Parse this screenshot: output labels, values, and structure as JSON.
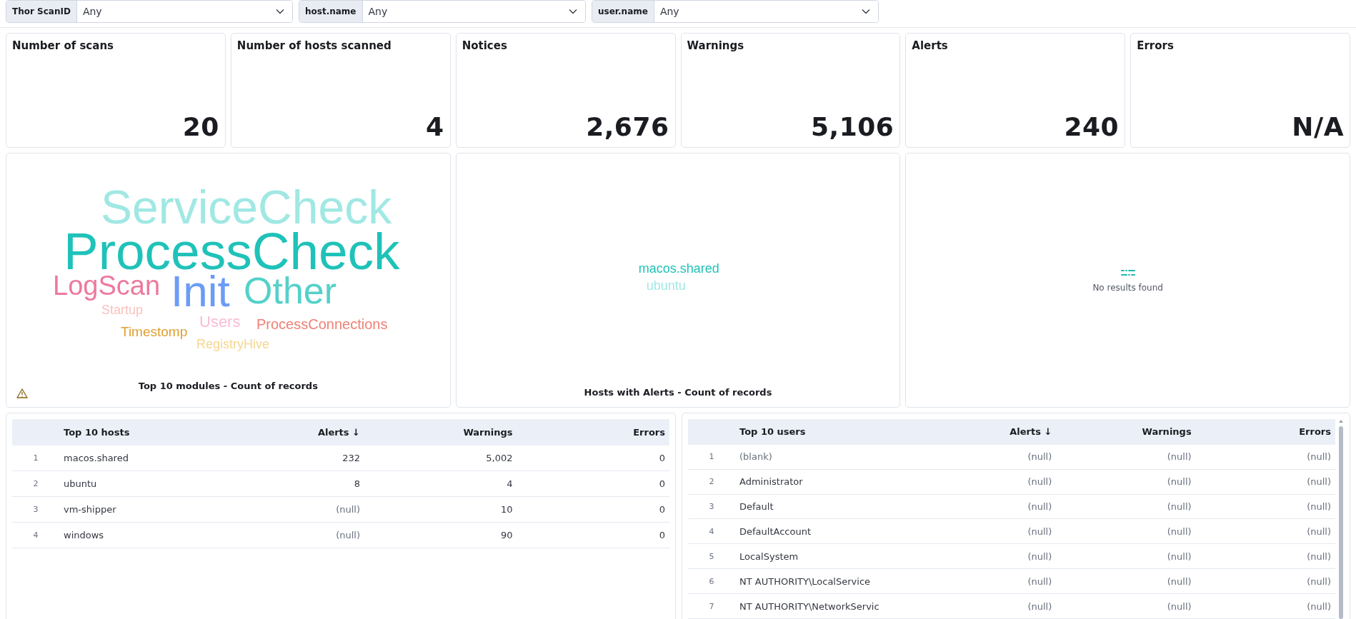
{
  "filters": [
    {
      "label": "Thor ScanID",
      "value": "Any"
    },
    {
      "label": "host.name",
      "value": "Any"
    },
    {
      "label": "user.name",
      "value": "Any"
    }
  ],
  "metrics": [
    {
      "title": "Number of scans",
      "value": "20"
    },
    {
      "title": "Number of hosts scanned",
      "value": "4"
    },
    {
      "title": "Notices",
      "value": "2,676"
    },
    {
      "title": "Warnings",
      "value": "5,106"
    },
    {
      "title": "Alerts",
      "value": "240"
    },
    {
      "title": "Errors",
      "value": "N/A"
    }
  ],
  "modules_cloud": {
    "title": "Top 10 modules - Count of records",
    "warning": true,
    "words": [
      {
        "text": "ServiceCheck",
        "color": "#a0e8e3"
      },
      {
        "text": "ProcessCheck",
        "color": "#1fc2b8"
      },
      {
        "text": "LogScan",
        "color": "#ec7a9e"
      },
      {
        "text": "Init",
        "color": "#6b9cf6"
      },
      {
        "text": "Other",
        "color": "#54d1c9"
      },
      {
        "text": "Startup",
        "color": "#f8c1bd"
      },
      {
        "text": "Users",
        "color": "#f9bcd6"
      },
      {
        "text": "ProcessConnections",
        "color": "#ef7f73"
      },
      {
        "text": "Timestomp",
        "color": "#dca032"
      },
      {
        "text": "RegistryHive",
        "color": "#f6d68e"
      }
    ]
  },
  "hosts_cloud": {
    "title": "Hosts with Alerts - Count of records",
    "words": [
      {
        "text": "macos.shared",
        "color": "#1fc2b8"
      },
      {
        "text": "ubuntu",
        "color": "#a0e8e3"
      }
    ]
  },
  "empty_panel": {
    "message": "No results found"
  },
  "hosts_table": {
    "columns": [
      "Top 10 hosts",
      "Alerts ↓",
      "Warnings",
      "Errors"
    ],
    "rows": [
      {
        "index": "1",
        "cells": [
          {
            "text": "macos.shared",
            "muted": false
          },
          {
            "text": "232",
            "muted": false
          },
          {
            "text": "5,002",
            "muted": false
          },
          {
            "text": "0",
            "muted": false
          }
        ]
      },
      {
        "index": "2",
        "cells": [
          {
            "text": "ubuntu",
            "muted": false
          },
          {
            "text": "8",
            "muted": false
          },
          {
            "text": "4",
            "muted": false
          },
          {
            "text": "0",
            "muted": false
          }
        ]
      },
      {
        "index": "3",
        "cells": [
          {
            "text": "vm-shipper",
            "muted": false
          },
          {
            "text": "(null)",
            "muted": true
          },
          {
            "text": "10",
            "muted": false
          },
          {
            "text": "0",
            "muted": false
          }
        ]
      },
      {
        "index": "4",
        "cells": [
          {
            "text": "windows",
            "muted": false
          },
          {
            "text": "(null)",
            "muted": true
          },
          {
            "text": "90",
            "muted": false
          },
          {
            "text": "0",
            "muted": false
          }
        ]
      }
    ]
  },
  "users_table": {
    "columns": [
      "Top 10 users",
      "Alerts ↓",
      "Warnings",
      "Errors"
    ],
    "rows": [
      {
        "index": "1",
        "cells": [
          {
            "text": "(blank)",
            "muted": true
          },
          {
            "text": "(null)",
            "muted": true
          },
          {
            "text": "(null)",
            "muted": true
          },
          {
            "text": "(null)",
            "muted": true
          }
        ]
      },
      {
        "index": "2",
        "cells": [
          {
            "text": "Administrator",
            "muted": false
          },
          {
            "text": "(null)",
            "muted": true
          },
          {
            "text": "(null)",
            "muted": true
          },
          {
            "text": "(null)",
            "muted": true
          }
        ]
      },
      {
        "index": "3",
        "cells": [
          {
            "text": "Default",
            "muted": false
          },
          {
            "text": "(null)",
            "muted": true
          },
          {
            "text": "(null)",
            "muted": true
          },
          {
            "text": "(null)",
            "muted": true
          }
        ]
      },
      {
        "index": "4",
        "cells": [
          {
            "text": "DefaultAccount",
            "muted": false
          },
          {
            "text": "(null)",
            "muted": true
          },
          {
            "text": "(null)",
            "muted": true
          },
          {
            "text": "(null)",
            "muted": true
          }
        ]
      },
      {
        "index": "5",
        "cells": [
          {
            "text": "LocalSystem",
            "muted": false
          },
          {
            "text": "(null)",
            "muted": true
          },
          {
            "text": "(null)",
            "muted": true
          },
          {
            "text": "(null)",
            "muted": true
          }
        ]
      },
      {
        "index": "6",
        "cells": [
          {
            "text": "NT AUTHORITY\\LocalService",
            "muted": false
          },
          {
            "text": "(null)",
            "muted": true
          },
          {
            "text": "(null)",
            "muted": true
          },
          {
            "text": "(null)",
            "muted": true
          }
        ]
      },
      {
        "index": "7",
        "cells": [
          {
            "text": "NT AUTHORITY\\NetworkServic",
            "muted": false
          },
          {
            "text": "(null)",
            "muted": true
          },
          {
            "text": "(null)",
            "muted": true
          },
          {
            "text": "(null)",
            "muted": true
          }
        ]
      }
    ]
  }
}
